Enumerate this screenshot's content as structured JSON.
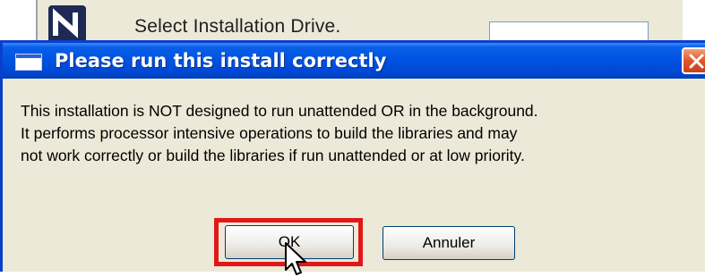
{
  "background_window": {
    "logo": "n-logo-icon",
    "prompt": "Select Installation Drive."
  },
  "dialog": {
    "title": "Please run this install correctly",
    "title_icon": "window-icon",
    "close_icon": "close-icon",
    "message_lines": [
      "This installation is NOT designed to run unattended OR in the background.",
      "It performs processor intensive operations to build the libraries and may",
      "not work correctly or build the libraries if run unattended or at low priority."
    ],
    "buttons": {
      "ok": "OK",
      "cancel": "Annuler"
    }
  },
  "annotation": {
    "highlight_color": "#e01818",
    "cursor": "mouse-pointer-icon"
  },
  "colors": {
    "titlebar": "#0054e3",
    "dialog_background": "#ece9d8",
    "close_button": "#e0552a"
  }
}
